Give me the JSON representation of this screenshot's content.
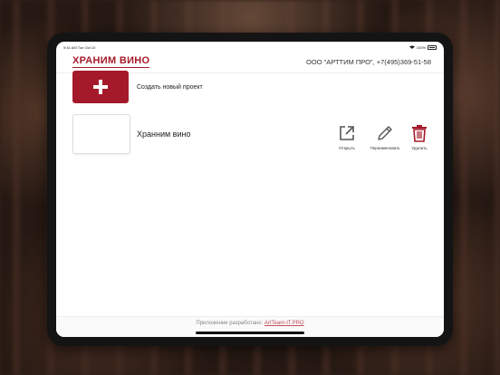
{
  "status": {
    "time": "9:41 AM",
    "date": "Tue Oct 10",
    "battery": "100%"
  },
  "header": {
    "brand": "ХРАНИМ ВИНО",
    "contact": "ООО \"АРТТИМ ПРО\", +7(495)369-51-58"
  },
  "new_project": {
    "label": "Создать новый проект"
  },
  "projects": [
    {
      "name": "Хранним вино",
      "actions": {
        "open": "Открыть",
        "rename": "Переименовать",
        "delete": "Удалить"
      }
    }
  ],
  "footer": {
    "text": "Приложение разработано:",
    "link": "ArtTeam-IT.PRO"
  },
  "colors": {
    "accent": "#a51a2a"
  }
}
